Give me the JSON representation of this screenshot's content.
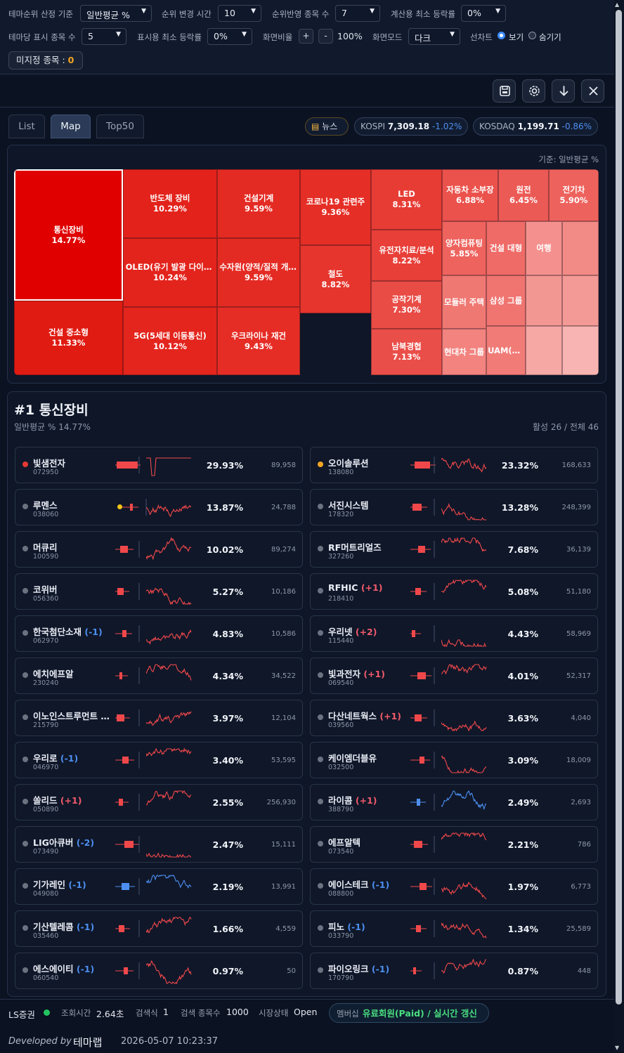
{
  "controls": {
    "row1": [
      {
        "label": "테마순위 산정 기준",
        "value": "일반평균 %"
      },
      {
        "label": "순위 변경 시간",
        "value": "10"
      },
      {
        "label": "순위반영 종목 수",
        "value": "7"
      },
      {
        "label": "계산용 최소 등락률",
        "value": "0%"
      }
    ],
    "row2": {
      "per_theme_label": "테마당 표시 종목 수",
      "per_theme_value": "5",
      "min_display_label": "표시용 최소 등락률",
      "min_display_value": "0%",
      "zoom_label": "화면비율",
      "zoom_plus": "+",
      "zoom_minus": "-",
      "zoom_value": "100%",
      "mode_label": "화면모드",
      "mode_value": "다크",
      "line_chart_label": "선차트",
      "show_label": "보기",
      "hide_label": "숨기기",
      "selected": "보기"
    },
    "unassigned_label": "미지정 종목 :",
    "unassigned_count": "0"
  },
  "toolbar_icons": [
    "save-icon",
    "gear-icon",
    "download-icon",
    "close-icon"
  ],
  "tabs": [
    {
      "label": "List",
      "active": false
    },
    {
      "label": "Map",
      "active": true
    },
    {
      "label": "Top50",
      "active": false
    }
  ],
  "market": {
    "news_label": "뉴스",
    "kospi": {
      "name": "KOSPI",
      "value": "7,309.18",
      "change": "-1.02%"
    },
    "kosdaq": {
      "name": "KOSDAQ",
      "value": "1,199.71",
      "change": "-0.86%"
    }
  },
  "treemap": {
    "basis": "기준: 일반평균 %",
    "tiles": [
      {
        "name": "통신장비",
        "pct": "14.77%",
        "color": "#e00000"
      },
      {
        "name": "건설 중소형",
        "pct": "11.33%",
        "color": "#e01b12"
      },
      {
        "name": "반도체 장비",
        "pct": "10.29%",
        "color": "#e3231b"
      },
      {
        "name": "OLED(유기 발광 다이오드)",
        "pct": "10.24%",
        "color": "#e3241c"
      },
      {
        "name": "5G(5세대 이동통신)",
        "pct": "10.12%",
        "color": "#e3251d"
      },
      {
        "name": "건설기계",
        "pct": "9.59%",
        "color": "#e42b23"
      },
      {
        "name": "수자원(양적/질적 개선)",
        "pct": "9.59%",
        "color": "#e42b23"
      },
      {
        "name": "우크라이나 재건",
        "pct": "9.43%",
        "color": "#e52d25"
      },
      {
        "name": "코로나19 관련주",
        "pct": "9.36%",
        "color": "#e52e26"
      },
      {
        "name": "철도",
        "pct": "8.82%",
        "color": "#e5352d"
      },
      {
        "name": "LED",
        "pct": "8.31%",
        "color": "#e63c34"
      },
      {
        "name": "유전자치료/분석",
        "pct": "8.22%",
        "color": "#e83f38"
      },
      {
        "name": "공작기계",
        "pct": "7.30%",
        "color": "#e94b45"
      },
      {
        "name": "남북경협",
        "pct": "7.13%",
        "color": "#ea4e48"
      },
      {
        "name": "자동차 소부장",
        "pct": "6.88%",
        "color": "#eb524c"
      },
      {
        "name": "원전",
        "pct": "6.45%",
        "color": "#ec5a55"
      },
      {
        "name": "전기차",
        "pct": "5.90%",
        "color": "#ee625d"
      },
      {
        "name": "양자컴퓨팅",
        "pct": "5.85%",
        "color": "#ee635e"
      },
      {
        "name": "건설 대형",
        "pct": "",
        "color": "#ef6b67"
      },
      {
        "name": "모듈러 주택",
        "pct": "",
        "color": "#f07873"
      },
      {
        "name": "삼성 그룹",
        "pct": "",
        "color": "#f07470"
      },
      {
        "name": "현대차 그룹",
        "pct": "",
        "color": "#f2837f"
      },
      {
        "name": "UAM(도심항공)",
        "pct": "",
        "color": "#f07b77"
      },
      {
        "name": "여행",
        "pct": "",
        "color": "#f4918e"
      },
      {
        "name": "",
        "pct": "",
        "color": "#f28a86"
      },
      {
        "name": "",
        "pct": "",
        "color": "#f39793"
      },
      {
        "name": "",
        "pct": "",
        "color": "#f49a96"
      },
      {
        "name": "",
        "pct": "",
        "color": "#f6a8a5"
      },
      {
        "name": "",
        "pct": "",
        "color": "#f8b4b2"
      }
    ]
  },
  "detail": {
    "title": "#1 통신장비",
    "subtitle": "일반평균 % 14.77%",
    "stats": "활성 26 / 전체 46",
    "stocks": [
      {
        "name": "빛샘전자",
        "code": "072950",
        "pct": "29.93%",
        "vol": "89,958",
        "dot": "#e53935",
        "badge": "",
        "badge_color": "",
        "extra": "",
        "color": "#f0484a"
      },
      {
        "name": "오이솔루션",
        "code": "138080",
        "pct": "23.32%",
        "vol": "168,633",
        "dot": "#f5a623",
        "badge": "",
        "badge_color": "",
        "extra": "",
        "color": "#f0484a"
      },
      {
        "name": "루멘스",
        "code": "038060",
        "pct": "13.87%",
        "vol": "24,788",
        "dot": "#6b7280",
        "badge": "",
        "badge_color": "",
        "extra": "#f5c518",
        "color": "#f0484a"
      },
      {
        "name": "서진시스템",
        "code": "178320",
        "pct": "13.28%",
        "vol": "248,399",
        "dot": "#6b7280",
        "badge": "",
        "badge_color": "",
        "extra": "",
        "color": "#f0484a"
      },
      {
        "name": "머큐리",
        "code": "100590",
        "pct": "10.02%",
        "vol": "89,274",
        "dot": "#6b7280",
        "badge": "",
        "badge_color": "",
        "extra": "",
        "color": "#f0484a"
      },
      {
        "name": "RF머트리얼즈",
        "code": "327260",
        "pct": "7.68%",
        "vol": "36,139",
        "dot": "#6b7280",
        "badge": "",
        "badge_color": "",
        "extra": "",
        "color": "#f0484a"
      },
      {
        "name": "코위버",
        "code": "056360",
        "pct": "5.27%",
        "vol": "10,186",
        "dot": "#6b7280",
        "badge": "",
        "badge_color": "",
        "extra": "",
        "color": "#f0484a"
      },
      {
        "name": "RFHIC",
        "code": "218410",
        "pct": "5.08%",
        "vol": "51,180",
        "dot": "#6b7280",
        "badge": "(+1)",
        "badge_color": "#f05a6a",
        "extra": "",
        "color": "#f0484a"
      },
      {
        "name": "한국첨단소재",
        "code": "062970",
        "pct": "4.83%",
        "vol": "10,586",
        "dot": "#6b7280",
        "badge": "(-1)",
        "badge_color": "#4d8ff0",
        "extra": "",
        "color": "#f0484a"
      },
      {
        "name": "우리넷",
        "code": "115440",
        "pct": "4.43%",
        "vol": "58,969",
        "dot": "#6b7280",
        "badge": "(+2)",
        "badge_color": "#f05a6a",
        "extra": "",
        "color": "#f0484a"
      },
      {
        "name": "에치에프알",
        "code": "230240",
        "pct": "4.34%",
        "vol": "34,522",
        "dot": "#6b7280",
        "badge": "",
        "badge_color": "",
        "extra": "",
        "color": "#f0484a"
      },
      {
        "name": "빛과전자",
        "code": "069540",
        "pct": "4.01%",
        "vol": "52,317",
        "dot": "#6b7280",
        "badge": "(+1)",
        "badge_color": "#f05a6a",
        "extra": "",
        "color": "#f0484a"
      },
      {
        "name": "이노인스트루먼트 (...",
        "code": "215790",
        "pct": "3.97%",
        "vol": "12,104",
        "dot": "#6b7280",
        "badge": "",
        "badge_color": "",
        "extra": "",
        "color": "#f0484a"
      },
      {
        "name": "다산네트웍스",
        "code": "039560",
        "pct": "3.63%",
        "vol": "4,040",
        "dot": "#6b7280",
        "badge": "(+1)",
        "badge_color": "#f05a6a",
        "extra": "",
        "color": "#f0484a"
      },
      {
        "name": "우리로",
        "code": "046970",
        "pct": "3.40%",
        "vol": "53,595",
        "dot": "#6b7280",
        "badge": "(-1)",
        "badge_color": "#4d8ff0",
        "extra": "",
        "color": "#f0484a"
      },
      {
        "name": "케이엠더블유",
        "code": "032500",
        "pct": "3.09%",
        "vol": "18,009",
        "dot": "#6b7280",
        "badge": "",
        "badge_color": "",
        "extra": "",
        "color": "#f0484a"
      },
      {
        "name": "쏠리드",
        "code": "050890",
        "pct": "2.55%",
        "vol": "256,930",
        "dot": "#6b7280",
        "badge": "(+1)",
        "badge_color": "#f05a6a",
        "extra": "",
        "color": "#f0484a"
      },
      {
        "name": "라이콤",
        "code": "388790",
        "pct": "2.49%",
        "vol": "2,693",
        "dot": "#6b7280",
        "badge": "(+1)",
        "badge_color": "#f05a6a",
        "extra": "",
        "color": "#4d8ff0"
      },
      {
        "name": "LIG아큐버",
        "code": "073490",
        "pct": "2.47%",
        "vol": "15,111",
        "dot": "#6b7280",
        "badge": "(-2)",
        "badge_color": "#4d8ff0",
        "extra": "",
        "color": "#f0484a"
      },
      {
        "name": "에프알텍",
        "code": "073540",
        "pct": "2.21%",
        "vol": "786",
        "dot": "#6b7280",
        "badge": "",
        "badge_color": "",
        "extra": "",
        "color": "#f0484a"
      },
      {
        "name": "기가레인",
        "code": "049080",
        "pct": "2.19%",
        "vol": "13,991",
        "dot": "#6b7280",
        "badge": "(-1)",
        "badge_color": "#4d8ff0",
        "extra": "",
        "color": "#4d8ff0"
      },
      {
        "name": "에이스테크",
        "code": "088800",
        "pct": "1.97%",
        "vol": "6,773",
        "dot": "#6b7280",
        "badge": "(-1)",
        "badge_color": "#4d8ff0",
        "extra": "",
        "color": "#f0484a"
      },
      {
        "name": "기산텔레콤",
        "code": "035460",
        "pct": "1.66%",
        "vol": "4,559",
        "dot": "#6b7280",
        "badge": "(-1)",
        "badge_color": "#4d8ff0",
        "extra": "",
        "color": "#f0484a"
      },
      {
        "name": "피노",
        "code": "033790",
        "pct": "1.34%",
        "vol": "25,589",
        "dot": "#6b7280",
        "badge": "(-1)",
        "badge_color": "#4d8ff0",
        "extra": "",
        "color": "#f0484a"
      },
      {
        "name": "에스에이티",
        "code": "060540",
        "pct": "0.97%",
        "vol": "50",
        "dot": "#6b7280",
        "badge": "(-1)",
        "badge_color": "#4d8ff0",
        "extra": "",
        "color": "#f0484a"
      },
      {
        "name": "파이오링크",
        "code": "170790",
        "pct": "0.87%",
        "vol": "448",
        "dot": "#6b7280",
        "badge": "(-1)",
        "badge_color": "#4d8ff0",
        "extra": "",
        "color": "#f0484a"
      }
    ]
  },
  "status": {
    "broker": "LS증권",
    "query_time_label": "조회시간",
    "query_time": "2.64초",
    "search_label": "검색식",
    "search_value": "1",
    "count_label": "검색 종목수",
    "count_value": "1000",
    "market_label": "시장상태",
    "market_value": "Open",
    "membership_label": "멤버십",
    "membership_value": "유료회원(Paid) / 실시간 갱신"
  },
  "footer": {
    "developed_by": "Developed by",
    "brand": "테마랩",
    "timestamp": "2026-05-07 10:23:37"
  }
}
